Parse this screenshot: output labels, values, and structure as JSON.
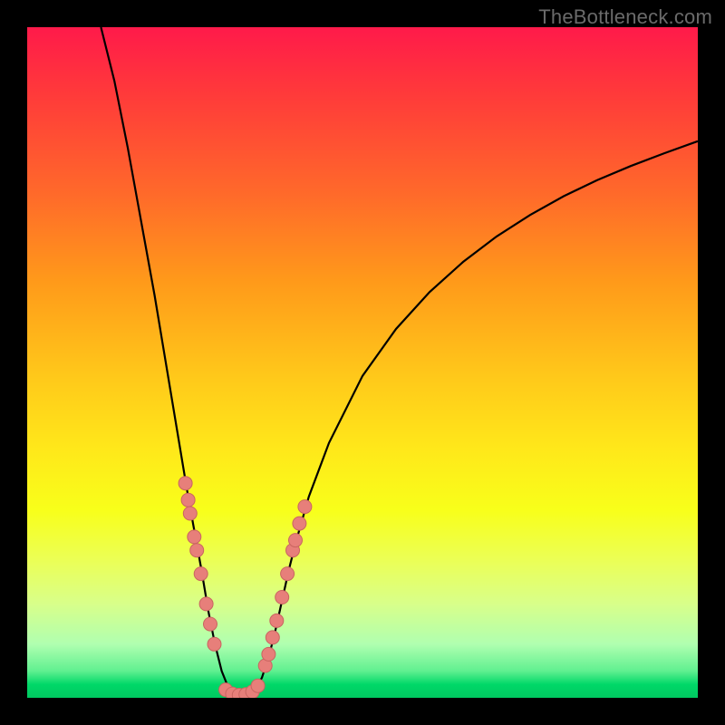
{
  "watermark_text": "TheBottleneck.com",
  "colors": {
    "marker_fill": "#e77f7a",
    "marker_stroke": "#c96560",
    "curve_stroke": "#000000"
  },
  "chart_data": {
    "type": "line",
    "title": "",
    "xlabel": "",
    "ylabel": "",
    "xlim": [
      0,
      100
    ],
    "ylim": [
      0,
      100
    ],
    "curves": {
      "left": [
        {
          "x": 11,
          "y": 100
        },
        {
          "x": 13,
          "y": 92
        },
        {
          "x": 15,
          "y": 82
        },
        {
          "x": 17,
          "y": 71
        },
        {
          "x": 19,
          "y": 60
        },
        {
          "x": 21,
          "y": 48
        },
        {
          "x": 23,
          "y": 36
        },
        {
          "x": 24,
          "y": 30
        },
        {
          "x": 25,
          "y": 24.5
        },
        {
          "x": 26,
          "y": 19
        },
        {
          "x": 27,
          "y": 13
        },
        {
          "x": 28,
          "y": 8
        },
        {
          "x": 29,
          "y": 4
        },
        {
          "x": 30,
          "y": 1.5
        },
        {
          "x": 31,
          "y": 0.6
        },
        {
          "x": 32,
          "y": 0.3
        }
      ],
      "right": [
        {
          "x": 32,
          "y": 0.3
        },
        {
          "x": 33,
          "y": 0.5
        },
        {
          "x": 34,
          "y": 1.2
        },
        {
          "x": 35,
          "y": 3
        },
        {
          "x": 36,
          "y": 6
        },
        {
          "x": 37,
          "y": 10
        },
        {
          "x": 38,
          "y": 14.5
        },
        {
          "x": 39,
          "y": 19
        },
        {
          "x": 40,
          "y": 23
        },
        {
          "x": 42,
          "y": 30
        },
        {
          "x": 45,
          "y": 38
        },
        {
          "x": 50,
          "y": 48
        },
        {
          "x": 55,
          "y": 55
        },
        {
          "x": 60,
          "y": 60.5
        },
        {
          "x": 65,
          "y": 65
        },
        {
          "x": 70,
          "y": 68.8
        },
        {
          "x": 75,
          "y": 72
        },
        {
          "x": 80,
          "y": 74.8
        },
        {
          "x": 85,
          "y": 77.2
        },
        {
          "x": 90,
          "y": 79.3
        },
        {
          "x": 95,
          "y": 81.2
        },
        {
          "x": 100,
          "y": 83
        }
      ]
    },
    "markers": {
      "left": [
        {
          "x": 23.6,
          "y": 32
        },
        {
          "x": 24.0,
          "y": 29.5
        },
        {
          "x": 24.3,
          "y": 27.5
        },
        {
          "x": 24.9,
          "y": 24
        },
        {
          "x": 25.3,
          "y": 22
        },
        {
          "x": 25.9,
          "y": 18.5
        },
        {
          "x": 26.7,
          "y": 14
        },
        {
          "x": 27.3,
          "y": 11
        },
        {
          "x": 27.9,
          "y": 8
        }
      ],
      "right": [
        {
          "x": 35.5,
          "y": 4.8
        },
        {
          "x": 36.0,
          "y": 6.5
        },
        {
          "x": 36.6,
          "y": 9
        },
        {
          "x": 37.2,
          "y": 11.5
        },
        {
          "x": 38.0,
          "y": 15
        },
        {
          "x": 38.8,
          "y": 18.5
        },
        {
          "x": 39.6,
          "y": 22
        },
        {
          "x": 40.0,
          "y": 23.5
        },
        {
          "x": 40.6,
          "y": 26
        },
        {
          "x": 41.4,
          "y": 28.5
        }
      ],
      "bottom": [
        {
          "x": 29.6,
          "y": 1.2
        },
        {
          "x": 30.6,
          "y": 0.6
        },
        {
          "x": 31.6,
          "y": 0.4
        },
        {
          "x": 32.6,
          "y": 0.5
        },
        {
          "x": 33.6,
          "y": 0.9
        },
        {
          "x": 34.4,
          "y": 1.8
        }
      ]
    }
  }
}
